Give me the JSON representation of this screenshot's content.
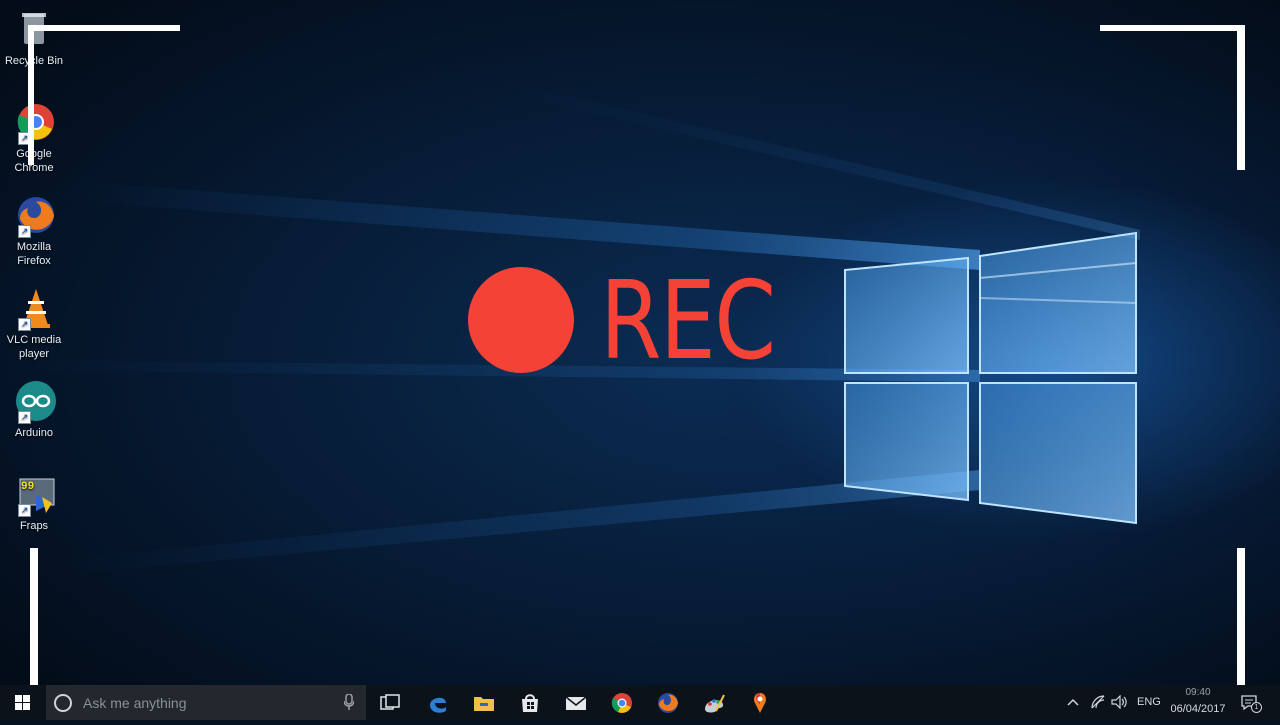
{
  "desktop": {
    "icons": [
      {
        "label": "Recycle Bin",
        "icon": "recycle-bin-icon"
      },
      {
        "label": "Google Chrome",
        "icon": "chrome-icon"
      },
      {
        "label": "Mozilla Firefox",
        "icon": "firefox-icon"
      },
      {
        "label": "VLC media player",
        "icon": "vlc-icon"
      },
      {
        "label": "Arduino",
        "icon": "arduino-icon"
      },
      {
        "label": "Fraps",
        "icon": "fraps-icon"
      }
    ]
  },
  "overlay": {
    "rec_label": "REC",
    "rec_color": "#f44336"
  },
  "taskbar": {
    "search_placeholder": "Ask me anything",
    "pinned": [
      "task-view-icon",
      "edge-icon",
      "file-explorer-icon",
      "store-icon",
      "mail-icon",
      "chrome-icon",
      "firefox-icon",
      "paint-icon",
      "maps-icon"
    ],
    "tray": {
      "language": "ENG",
      "time": "09:40",
      "date": "06/04/2017",
      "notification_count": "1"
    }
  }
}
